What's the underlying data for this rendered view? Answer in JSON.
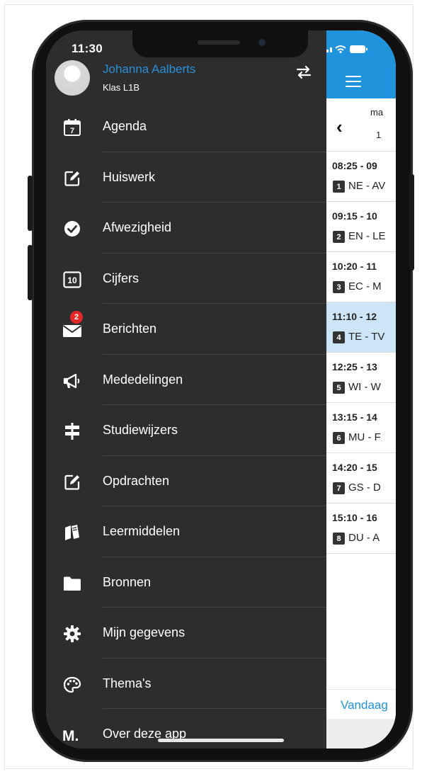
{
  "status": {
    "time": "11:30"
  },
  "user": {
    "name": "Johanna  Aalberts",
    "class": "Klas L1B"
  },
  "menu": [
    {
      "label": "Agenda",
      "icon": "calendar-icon",
      "badge": ""
    },
    {
      "label": "Huiswerk",
      "icon": "edit-icon",
      "badge": ""
    },
    {
      "label": "Afwezigheid",
      "icon": "check-circle-icon",
      "badge": ""
    },
    {
      "label": "Cijfers",
      "icon": "grade-icon",
      "badge": ""
    },
    {
      "label": "Berichten",
      "icon": "mail-icon",
      "badge": "2"
    },
    {
      "label": "Mededelingen",
      "icon": "megaphone-icon",
      "badge": ""
    },
    {
      "label": "Studiewijzers",
      "icon": "signpost-icon",
      "badge": ""
    },
    {
      "label": "Opdrachten",
      "icon": "edit-icon",
      "badge": ""
    },
    {
      "label": "Leermiddelen",
      "icon": "books-icon",
      "badge": ""
    },
    {
      "label": "Bronnen",
      "icon": "folder-icon",
      "badge": ""
    },
    {
      "label": "Mijn gegevens",
      "icon": "gear-icon",
      "badge": ""
    },
    {
      "label": "Thema's",
      "icon": "palette-icon",
      "badge": ""
    },
    {
      "label": "Over deze app",
      "icon": "app-logo-icon",
      "badge": ""
    }
  ],
  "calendar": {
    "day_name": "ma",
    "day_number": "1",
    "today_label": "Vandaag",
    "lessons": [
      {
        "time": "08:25 - 09",
        "num": "1",
        "subject": "NE - AV",
        "active": false
      },
      {
        "time": "09:15 - 10",
        "num": "2",
        "subject": "EN - LE",
        "active": false
      },
      {
        "time": "10:20 - 11",
        "num": "3",
        "subject": "EC - M",
        "active": false
      },
      {
        "time": "11:10 - 12",
        "num": "4",
        "subject": "TE - TV",
        "active": true
      },
      {
        "time": "12:25 - 13",
        "num": "5",
        "subject": "WI - W",
        "active": false
      },
      {
        "time": "13:15 - 14",
        "num": "6",
        "subject": "MU - F",
        "active": false
      },
      {
        "time": "14:20 - 15",
        "num": "7",
        "subject": "GS - D",
        "active": false
      },
      {
        "time": "15:10 - 16",
        "num": "8",
        "subject": "DU - A",
        "active": false
      }
    ]
  },
  "colors": {
    "accent": "#1f93dc",
    "drawer_bg": "#2d2d2d",
    "badge": "#e82828",
    "active_lesson": "#cde6f7"
  }
}
